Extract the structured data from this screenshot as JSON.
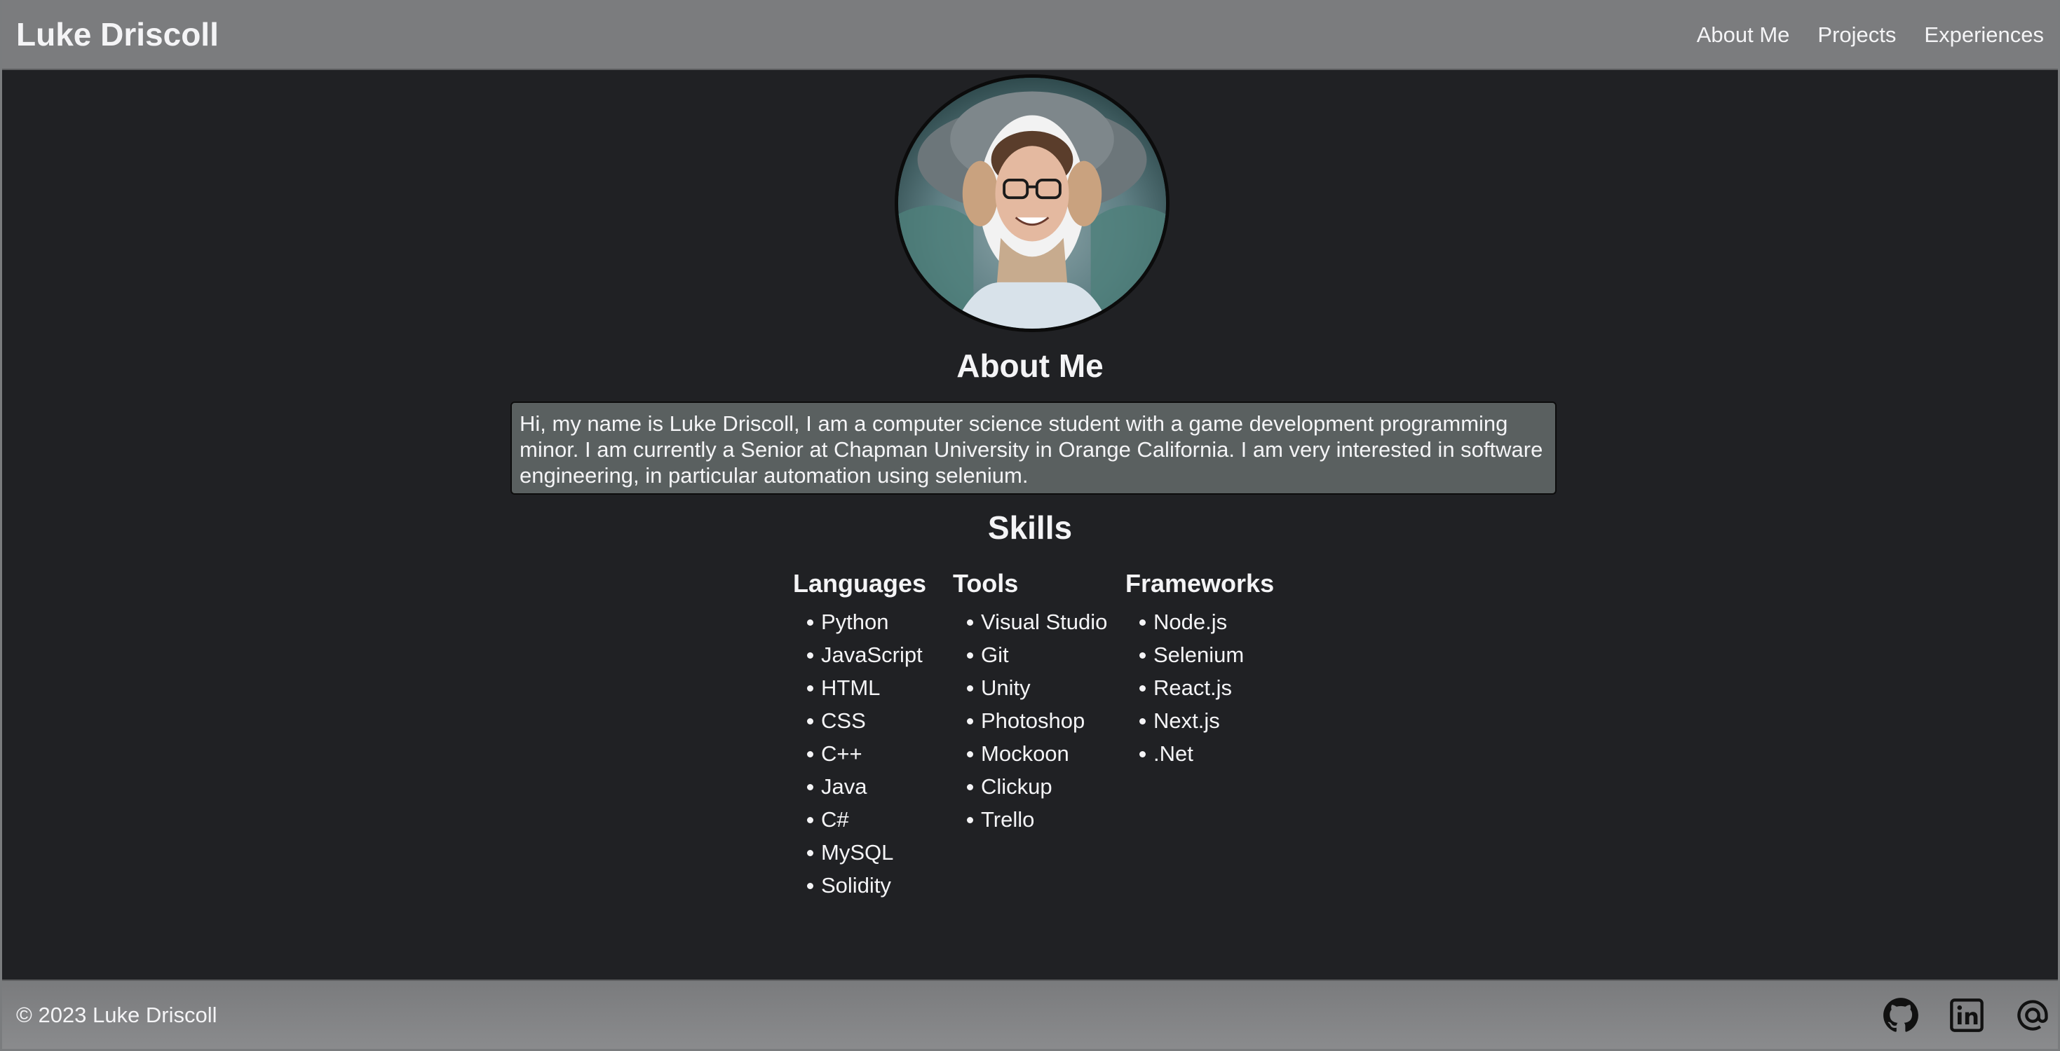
{
  "header": {
    "brand": "Luke Driscoll",
    "nav": [
      "About Me",
      "Projects",
      "Experiences"
    ]
  },
  "profile": {
    "avatar_icon": "profile-photo"
  },
  "about": {
    "title": "About Me",
    "text": "Hi, my name is Luke Driscoll, I am a computer science student with a game development programming minor. I am currently a Senior at Chapman University in Orange California. I am very interested in software engineering, in particular automation using selenium."
  },
  "skills": {
    "title": "Skills",
    "columns": [
      {
        "heading": "Languages",
        "items": [
          "Python",
          "JavaScript",
          "HTML",
          "CSS",
          "C++",
          "Java",
          "C#",
          "MySQL",
          "Solidity"
        ]
      },
      {
        "heading": "Tools",
        "items": [
          "Visual Studio",
          "Git",
          "Unity",
          "Photoshop",
          "Mockoon",
          "Clickup",
          "Trello"
        ]
      },
      {
        "heading": "Frameworks",
        "items": [
          "Node.js",
          "Selenium",
          "React.js",
          "Next.js",
          ".Net"
        ]
      }
    ]
  },
  "footer": {
    "copyright": "© 2023 Luke Driscoll",
    "icons": [
      "github-icon",
      "linkedin-icon",
      "email-icon"
    ]
  },
  "colors": {
    "header_bg": "#7b7c7e",
    "page_bg": "#202124",
    "about_box_bg": "#5a6060",
    "text": "#f4f4f6"
  }
}
